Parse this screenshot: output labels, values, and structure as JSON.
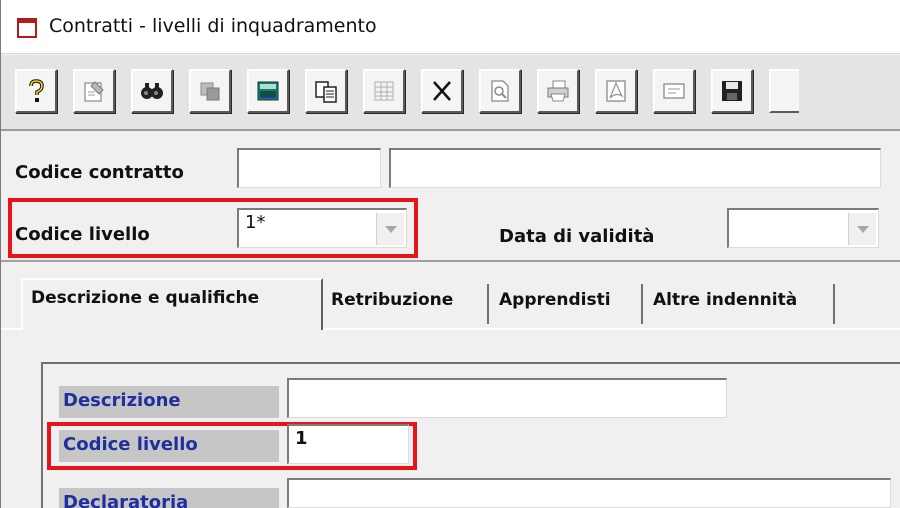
{
  "window": {
    "title": "Contratti - livelli di inquadramento"
  },
  "toolbar": {
    "buttons": [
      {
        "name": "help-icon"
      },
      {
        "name": "properties-icon"
      },
      {
        "name": "find-icon"
      },
      {
        "name": "copy-disabled-icon"
      },
      {
        "name": "calculator-icon"
      },
      {
        "name": "paste-icon"
      },
      {
        "name": "grid-icon"
      },
      {
        "name": "delete-icon"
      },
      {
        "name": "preview-icon"
      },
      {
        "name": "print-icon"
      },
      {
        "name": "pdf-icon"
      },
      {
        "name": "form-icon"
      },
      {
        "name": "save-icon"
      }
    ]
  },
  "header": {
    "codice_contratto_label": "Codice contratto",
    "codice_contratto_value": "",
    "contratto_descr_value": "",
    "codice_livello_label": "Codice livello",
    "codice_livello_value": "1*",
    "data_validita_label": "Data di validità",
    "data_validita_value": ""
  },
  "tabs": {
    "descrizione": "Descrizione e qualifiche",
    "retribuzione": "Retribuzione",
    "apprendisti": "Apprendisti",
    "altre": "Altre indennità"
  },
  "panel": {
    "descrizione_label": "Descrizione",
    "descrizione_value": "",
    "codice_livello_label": "Codice livello",
    "codice_livello_value": "1",
    "declaratoria_label": "Declaratoria",
    "declaratoria_value": ""
  },
  "colors": {
    "highlight": "#e8141b",
    "label_blue": "#1f2f9c"
  }
}
